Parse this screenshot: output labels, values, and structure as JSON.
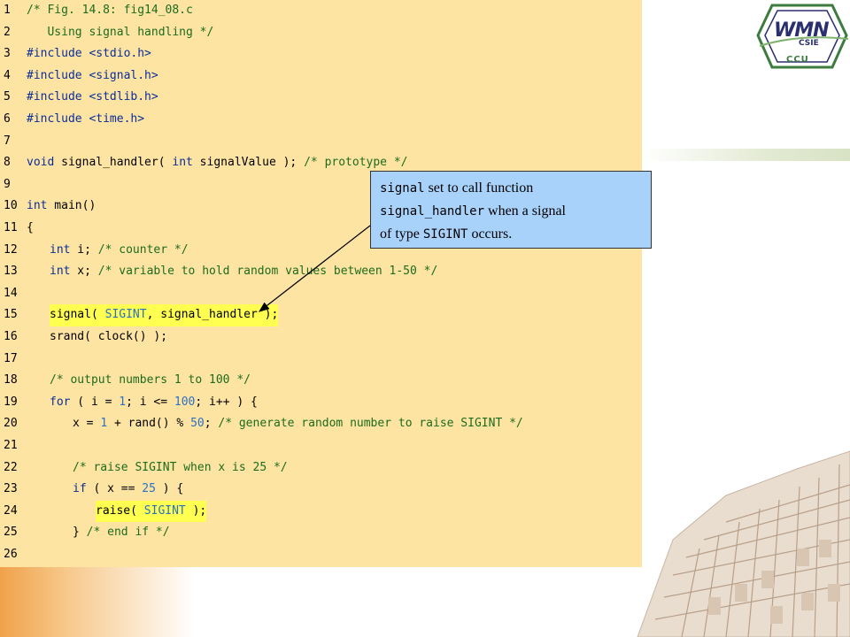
{
  "logo": {
    "brand": "WMN",
    "sub": "CSIE",
    "org": "CCU"
  },
  "code": {
    "lines": [
      {
        "n": "1",
        "indent": 0,
        "segs": [
          {
            "t": "/* Fig. 14.8: fig14_08.c",
            "c": "cm"
          }
        ]
      },
      {
        "n": "2",
        "indent": 0,
        "segs": [
          {
            "t": "   Using signal handling */",
            "c": "cm"
          }
        ]
      },
      {
        "n": "3",
        "indent": 0,
        "segs": [
          {
            "t": "#include <stdio.h>",
            "c": "kw"
          }
        ]
      },
      {
        "n": "4",
        "indent": 0,
        "segs": [
          {
            "t": "#include <signal.h>",
            "c": "kw"
          }
        ]
      },
      {
        "n": "5",
        "indent": 0,
        "segs": [
          {
            "t": "#include <stdlib.h>",
            "c": "kw"
          }
        ]
      },
      {
        "n": "6",
        "indent": 0,
        "segs": [
          {
            "t": "#include <time.h>",
            "c": "kw"
          }
        ]
      },
      {
        "n": "7",
        "indent": 0,
        "segs": []
      },
      {
        "n": "8",
        "indent": 0,
        "segs": [
          {
            "t": "void",
            "c": "kw"
          },
          {
            "t": " signal_handler( ",
            "c": ""
          },
          {
            "t": "int",
            "c": "kw"
          },
          {
            "t": " signalValue ); ",
            "c": ""
          },
          {
            "t": "/* prototype */",
            "c": "cm"
          }
        ]
      },
      {
        "n": "9",
        "indent": 0,
        "segs": []
      },
      {
        "n": "10",
        "indent": 0,
        "segs": [
          {
            "t": "int",
            "c": "kw"
          },
          {
            "t": " main()",
            "c": ""
          }
        ]
      },
      {
        "n": "11",
        "indent": 0,
        "segs": [
          {
            "t": "{",
            "c": ""
          }
        ]
      },
      {
        "n": "12",
        "indent": 1,
        "segs": [
          {
            "t": "int",
            "c": "kw"
          },
          {
            "t": " i; ",
            "c": ""
          },
          {
            "t": "/* counter */",
            "c": "cm"
          }
        ]
      },
      {
        "n": "13",
        "indent": 1,
        "segs": [
          {
            "t": "int",
            "c": "kw"
          },
          {
            "t": " x; ",
            "c": ""
          },
          {
            "t": "/* variable to hold random values between 1-50 */",
            "c": "cm"
          }
        ]
      },
      {
        "n": "14",
        "indent": 0,
        "segs": []
      },
      {
        "n": "15",
        "indent": 1,
        "hl": true,
        "segs": [
          {
            "t": "signal( ",
            "c": ""
          },
          {
            "t": "SIGINT",
            "c": "num"
          },
          {
            "t": ", signal_handler );",
            "c": ""
          }
        ]
      },
      {
        "n": "16",
        "indent": 1,
        "segs": [
          {
            "t": "srand( clock() );",
            "c": ""
          }
        ]
      },
      {
        "n": "17",
        "indent": 0,
        "segs": []
      },
      {
        "n": "18",
        "indent": 1,
        "segs": [
          {
            "t": "/* output numbers 1 to 100 */",
            "c": "cm"
          }
        ]
      },
      {
        "n": "19",
        "indent": 1,
        "segs": [
          {
            "t": "for",
            "c": "kw"
          },
          {
            "t": " ( i = ",
            "c": ""
          },
          {
            "t": "1",
            "c": "num"
          },
          {
            "t": "; i <= ",
            "c": ""
          },
          {
            "t": "100",
            "c": "num"
          },
          {
            "t": "; i++ ) {",
            "c": ""
          }
        ]
      },
      {
        "n": "20",
        "indent": 2,
        "segs": [
          {
            "t": "x = ",
            "c": ""
          },
          {
            "t": "1",
            "c": "num"
          },
          {
            "t": " + rand() % ",
            "c": ""
          },
          {
            "t": "50",
            "c": "num"
          },
          {
            "t": "; ",
            "c": ""
          },
          {
            "t": "/* generate random number to raise SIGINT */",
            "c": "cm"
          }
        ]
      },
      {
        "n": "21",
        "indent": 0,
        "segs": []
      },
      {
        "n": "22",
        "indent": 2,
        "segs": [
          {
            "t": "/* raise SIGINT when x is 25 */",
            "c": "cm"
          }
        ]
      },
      {
        "n": "23",
        "indent": 2,
        "segs": [
          {
            "t": "if",
            "c": "kw"
          },
          {
            "t": " ( x == ",
            "c": ""
          },
          {
            "t": "25",
            "c": "num"
          },
          {
            "t": " ) {",
            "c": ""
          }
        ]
      },
      {
        "n": "24",
        "indent": 3,
        "hl": true,
        "segs": [
          {
            "t": "raise( ",
            "c": ""
          },
          {
            "t": "SIGINT",
            "c": "num"
          },
          {
            "t": " );",
            "c": ""
          }
        ]
      },
      {
        "n": "25",
        "indent": 2,
        "segs": [
          {
            "t": "} ",
            "c": ""
          },
          {
            "t": "/* end if */",
            "c": "cm"
          }
        ]
      },
      {
        "n": "26",
        "indent": 0,
        "segs": []
      }
    ]
  },
  "callout": {
    "p1": "signal",
    "t1": " set to call function",
    "p2": "signal_handler",
    "t2": " when a signal",
    "t3": "of type ",
    "p3": "SIGINT",
    "t4": " occurs."
  }
}
